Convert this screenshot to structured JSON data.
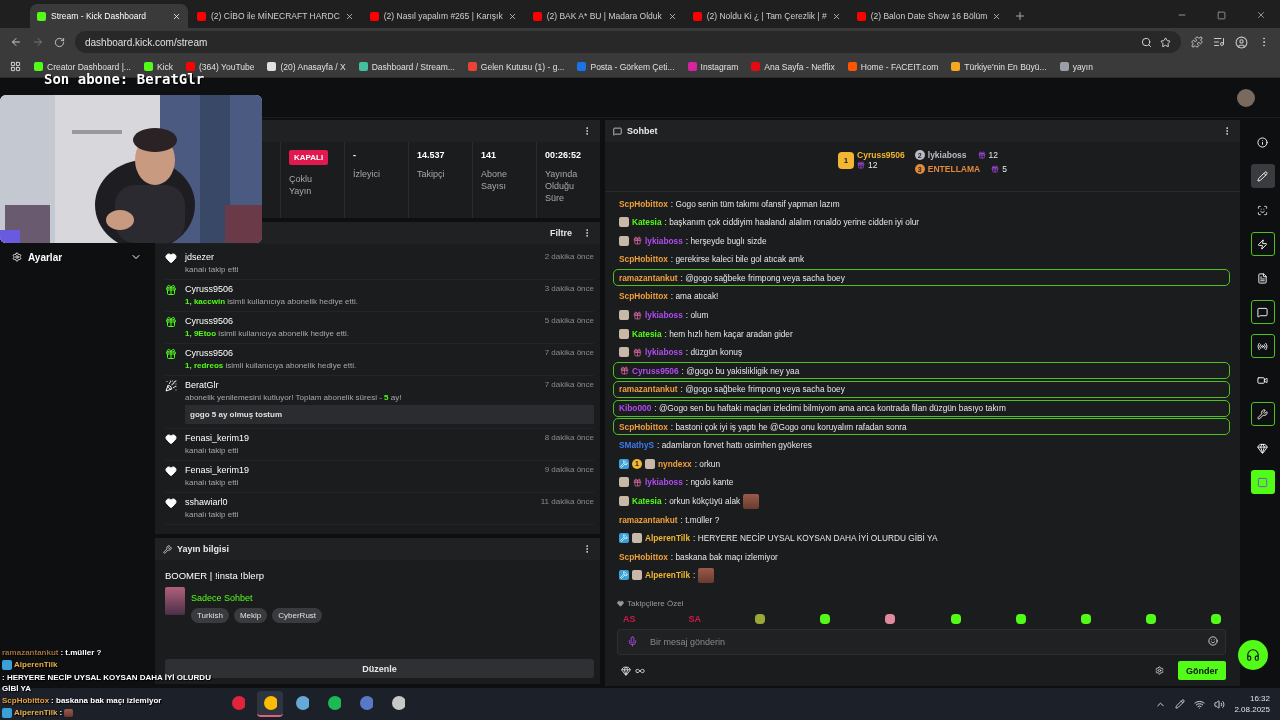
{
  "browser": {
    "tabs": [
      {
        "title": "Stream - Kick Dashboard",
        "selected": true
      },
      {
        "title": "(2) CİBO ile MİNECRAFT HARDC",
        "selected": false
      },
      {
        "title": "(2) Nasıl yapalım #265 | Karışık",
        "selected": false
      },
      {
        "title": "(2) BAK A* BU | Madara Olduk",
        "selected": false
      },
      {
        "title": "(2) Noldu Ki ¿ | Tam Çerezlik | #",
        "selected": false
      },
      {
        "title": "(2) Balon Date Show 16 Bölüm",
        "selected": false
      }
    ],
    "url": "dashboard.kick.com/stream",
    "bookmarks": [
      {
        "label": "Creator Dashboard |...",
        "color": "#53fc18"
      },
      {
        "label": "Kick",
        "color": "#53fc18"
      },
      {
        "label": "(364) YouTube",
        "color": "#ff0000"
      },
      {
        "label": "(20) Anasayfa / X",
        "color": "#e0e0e0"
      },
      {
        "label": "Dashboard / Stream...",
        "color": "#44c0a0"
      },
      {
        "label": "Gelen Kutusu (1) - g...",
        "color": "#ea4335"
      },
      {
        "label": "Posta - Görkem Çeti...",
        "color": "#1a73e8"
      },
      {
        "label": "Instagram",
        "color": "#d6249f"
      },
      {
        "label": "Ana Sayfa - Netflix",
        "color": "#e50914"
      },
      {
        "label": "Home - FACEIT.com",
        "color": "#ff5500"
      },
      {
        "label": "Türkiye'nin En Büyü...",
        "color": "#f5a623"
      },
      {
        "label": "yayın",
        "color": "#9aa0a6"
      }
    ]
  },
  "overlay": {
    "last_sub": "Son abone: BeratGlr",
    "chat": [
      {
        "user": "ramazantankut",
        "color": "#a0703a",
        "text": ": t.müller ?",
        "badges": false,
        "emote": false
      },
      {
        "user": "AlperenTilk",
        "color": "#e8b04a",
        "text": ": HERYERE NECİP UYSAL KOYSAN DAHA İYİ OLURDU GİBİ YA",
        "badges": true,
        "emote": false
      },
      {
        "user": "ScpHobittox",
        "color": "#e8a040",
        "text": ": baskana bak maçı izlemiyor",
        "badges": false,
        "emote": false
      },
      {
        "user": "AlperenTilk",
        "color": "#e8b04a",
        "text": ":",
        "badges": true,
        "emote": true
      }
    ]
  },
  "sidebar": {
    "items": [
      {
        "label": "Ayarlar",
        "expanded": false
      }
    ]
  },
  "stats": [
    {
      "kind": "badge",
      "value": "KAPALI",
      "label": "Çoklu Yayın"
    },
    {
      "kind": "text",
      "value": "-",
      "label": "İzleyici"
    },
    {
      "kind": "text",
      "value": "14.537",
      "label": "Takipçi"
    },
    {
      "kind": "text",
      "value": "141",
      "label": "Abone Sayısı"
    },
    {
      "kind": "text",
      "value": "00:26:52",
      "label": "Yayında Olduğu Süre"
    }
  ],
  "activity": {
    "filter": "Filtre",
    "items": [
      {
        "kind": "follow",
        "user": "jdsezer",
        "time": "2 dakika önce",
        "detail": [
          {
            "text": "kanalı takip etti",
            "accent": false
          }
        ]
      },
      {
        "kind": "gift",
        "user": "Cyruss9506",
        "time": "3 dakika önce",
        "detail": [
          {
            "text": "1, kaccwin",
            "accent": true
          },
          {
            "text": " isimli kullanıcıya abonelik hediye etti.",
            "accent": false
          }
        ]
      },
      {
        "kind": "gift",
        "user": "Cyruss9506",
        "time": "5 dakika önce",
        "detail": [
          {
            "text": "1, 9Etoo",
            "accent": true
          },
          {
            "text": " isimli kullanıcıya abonelik hediye etti.",
            "accent": false
          }
        ]
      },
      {
        "kind": "gift",
        "user": "Cyruss9506",
        "time": "7 dakika önce",
        "detail": [
          {
            "text": "1, redreos",
            "accent": true
          },
          {
            "text": " isimli kullanıcıya abonelik hediye etti.",
            "accent": false
          }
        ]
      },
      {
        "kind": "resub",
        "user": "BeratGlr",
        "time": "7 dakika önce",
        "detail": [
          {
            "text": "abonelik yenilemesini kutluyor! Toplam abonelik süresi - ",
            "accent": false
          },
          {
            "text": "5",
            "accent": true
          },
          {
            "text": " ay!",
            "accent": false
          }
        ],
        "message": "gogo 5 ay olmuş tostum"
      },
      {
        "kind": "follow",
        "user": "Fenasi_kerim19",
        "time": "8 dakika önce",
        "detail": [
          {
            "text": "kanalı takip etti",
            "accent": false
          }
        ]
      },
      {
        "kind": "follow",
        "user": "Fenasi_kerim19",
        "time": "9 dakika önce",
        "detail": [
          {
            "text": "kanalı takip etti",
            "accent": false
          }
        ]
      },
      {
        "kind": "follow",
        "user": "sshawiarl0",
        "time": "11 dakika önce",
        "detail": [
          {
            "text": "kanalı takip etti",
            "accent": false
          }
        ]
      }
    ]
  },
  "stream_info": {
    "title": "Yayın bilgisi",
    "stream_title": "BOOMER | !insta !blerp",
    "category": "Sadece Sohbet",
    "tags": [
      "Turkish",
      "Mekip",
      "CyberRust"
    ],
    "edit_button": "Düzenle"
  },
  "chat": {
    "title": "Sohbet",
    "top_gifters": [
      {
        "rank": "1",
        "user": "Cyruss9506",
        "count": "12",
        "color": "#f2b632"
      },
      {
        "rank": "2",
        "user": "lykiaboss",
        "count": "12",
        "color": "#b8bcc4"
      },
      {
        "rank": "3",
        "user": "ENTELLAMA",
        "count": "5",
        "color": "#e08a3a"
      }
    ],
    "messages": [
      {
        "user": "ScpHobittox",
        "color": "#f0a03c",
        "text": ": Gogo senin tüm takımı ofansif yapman lazım",
        "highlighted": false
      },
      {
        "user": "Katesia",
        "color": "#53fc18",
        "text": ": başkanım çok ciddiyim haalandı alalım ronaldo yerine cidden iyi olur",
        "highlighted": false,
        "badges": [
          {
            "kind": "avatar"
          }
        ]
      },
      {
        "user": "lykiaboss",
        "color": "#b04cf0",
        "text": ": herşeyde buglı sizde",
        "highlighted": false,
        "badges": [
          {
            "kind": "avatar"
          },
          {
            "kind": "gift"
          }
        ]
      },
      {
        "user": "ScpHobittox",
        "color": "#f0a03c",
        "text": ": gerekirse kaleci bile gol atıcak amk",
        "highlighted": false
      },
      {
        "user": "ramazantankut",
        "color": "#f0a03c",
        "text": ": @gogo sağbeke frimpong veya sacha boey",
        "highlighted": true
      },
      {
        "user": "ScpHobittox",
        "color": "#f0a03c",
        "text": ": ama atıcak!",
        "highlighted": false
      },
      {
        "user": "lykiaboss",
        "color": "#b04cf0",
        "text": ": olum",
        "highlighted": false,
        "badges": [
          {
            "kind": "avatar"
          },
          {
            "kind": "gift"
          }
        ]
      },
      {
        "user": "Katesia",
        "color": "#53fc18",
        "text": ": hem hızlı hem kaçar aradan gider",
        "highlighted": false,
        "badges": [
          {
            "kind": "avatar"
          }
        ]
      },
      {
        "user": "lykiaboss",
        "color": "#b04cf0",
        "text": ": düzgün konuş",
        "highlighted": false,
        "badges": [
          {
            "kind": "avatar"
          },
          {
            "kind": "gift"
          }
        ]
      },
      {
        "user": "Cyruss9506",
        "color": "#b04cf0",
        "text": ": @gogo bu yakislikligik ney yaa",
        "highlighted": true,
        "badges": [
          {
            "kind": "gift"
          }
        ]
      },
      {
        "user": "ramazantankut",
        "color": "#f0a03c",
        "text": ": @gogo sağbeke frimpong veya sacha boey",
        "highlighted": true
      },
      {
        "user": "Kibo000",
        "color": "#b04cf0",
        "text": ": @Gogo sen bu haftaki maçları izledimi bilmiyom ama anca kontrada filan düzgün basıyo takım",
        "highlighted": true
      },
      {
        "user": "ScpHobittox",
        "color": "#f0a03c",
        "text": ": bastoni çok iyi iş yaptı he @Gogo onu koruyalım rafadan sonra",
        "highlighted": true
      },
      {
        "user": "SMathyS",
        "color": "#3c7cf0",
        "text": ": adamlaron forvet hattı osimhen gyökeres",
        "highlighted": false
      },
      {
        "user": "nyndexx",
        "color": "#f0a03c",
        "text": ": orkun",
        "highlighted": false,
        "badges": [
          {
            "kind": "mod"
          },
          {
            "kind": "rank",
            "label": "1"
          },
          {
            "kind": "avatar"
          }
        ]
      },
      {
        "user": "lykiaboss",
        "color": "#b04cf0",
        "text": ": ngolo kante",
        "highlighted": false,
        "badges": [
          {
            "kind": "avatar"
          },
          {
            "kind": "gift"
          }
        ]
      },
      {
        "user": "Katesia",
        "color": "#53fc18",
        "text": ": orkun kökçüyü alak",
        "highlighted": false,
        "badges": [
          {
            "kind": "avatar"
          }
        ],
        "emote": true
      },
      {
        "user": "ramazantankut",
        "color": "#f0a03c",
        "text": ": t.müller ?",
        "highlighted": false
      },
      {
        "user": "AlperenTilk",
        "color": "#f2b632",
        "text": ": HERYERE NECİP UYSAL KOYSAN DAHA İYİ OLURDU GİBİ YA",
        "highlighted": false,
        "badges": [
          {
            "kind": "mod"
          },
          {
            "kind": "avatar"
          }
        ]
      },
      {
        "user": "ScpHobittox",
        "color": "#f0a03c",
        "text": ": baskana bak maçı izlemiyor",
        "highlighted": false
      },
      {
        "user": "AlperenTilk",
        "color": "#f2b632",
        "text": ":",
        "highlighted": false,
        "badges": [
          {
            "kind": "mod"
          },
          {
            "kind": "avatar"
          }
        ],
        "emote": true
      }
    ],
    "followers_only": "Takipçilere Özel",
    "emotes": [
      {
        "kind": "text",
        "label": "AS"
      },
      {
        "kind": "text",
        "label": "SA"
      },
      {
        "kind": "icon",
        "color": "#9aa83a"
      },
      {
        "kind": "icon",
        "color": "#53fc18"
      },
      {
        "kind": "icon",
        "color": "#e08aa0"
      },
      {
        "kind": "icon",
        "color": "#53fc18"
      },
      {
        "kind": "icon",
        "color": "#53fc18"
      },
      {
        "kind": "icon",
        "color": "#53fc18"
      },
      {
        "kind": "icon",
        "color": "#53fc18"
      },
      {
        "kind": "icon",
        "color": "#53fc18"
      }
    ],
    "placeholder": "Bir mesaj gönderin",
    "send": "Gönder"
  },
  "rail": [
    {
      "kind": "tool",
      "selected": false,
      "on": false
    },
    {
      "kind": "tool",
      "selected": true,
      "on": false
    },
    {
      "kind": "tool",
      "selected": false,
      "on": false
    },
    {
      "kind": "tool",
      "selected": false,
      "on": true
    },
    {
      "kind": "tool",
      "selected": false,
      "on": false
    },
    {
      "kind": "tool",
      "selected": false,
      "on": true
    },
    {
      "kind": "tool",
      "selected": false,
      "on": true
    },
    {
      "kind": "tool",
      "selected": false,
      "on": false
    },
    {
      "kind": "tool",
      "selected": false,
      "on": true
    },
    {
      "kind": "tool",
      "selected": false,
      "on": false
    },
    {
      "kind": "app",
      "on": true
    }
  ],
  "taskbar": {
    "apps": [
      {
        "active": false
      },
      {
        "active": true
      },
      {
        "active": false
      },
      {
        "active": false
      },
      {
        "active": false
      },
      {
        "active": false
      }
    ],
    "time": "16:32",
    "date": "2.08.2025"
  }
}
